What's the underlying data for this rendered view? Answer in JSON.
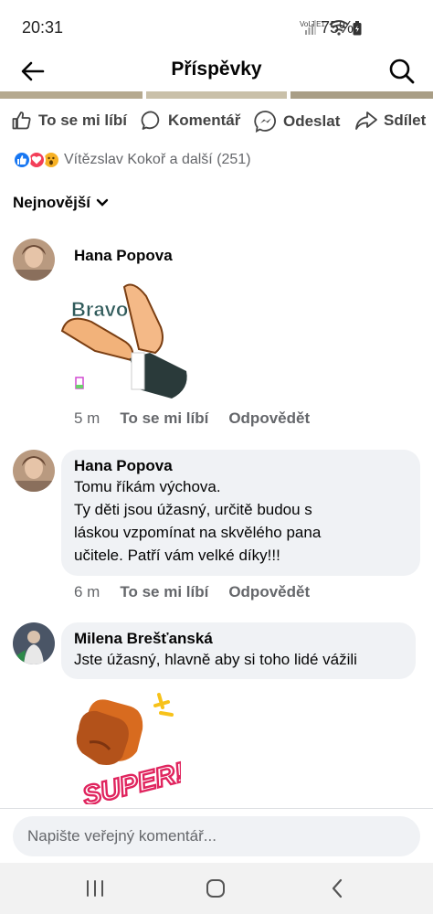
{
  "status_bar": {
    "time": "20:31",
    "battery": "75%",
    "network": "VoLTE1"
  },
  "header": {
    "title": "Příspěvky",
    "back_icon": "arrow-left-icon",
    "search_icon": "search-icon"
  },
  "actions": {
    "like": "To se mi líbí",
    "comment": "Komentář",
    "send": "Odeslat",
    "share": "Sdílet"
  },
  "reactions": {
    "summary": "Vítězslav Kokoř a další (251)",
    "icons": [
      "like-reaction-icon",
      "love-reaction-icon",
      "wow-reaction-icon"
    ]
  },
  "sort": {
    "label": "Nejnovější"
  },
  "comments": [
    {
      "author": "Hana Popova",
      "sticker_text": "Bravo",
      "time": "5 m",
      "like": "To se mi líbí",
      "reply": "Odpovědět"
    },
    {
      "author": "Hana Popova",
      "lines": [
        "Tomu říkám výchova.",
        "Ty děti jsou úžasný, určitě budou s",
        "láskou vzpomínat na skvělého pana",
        "učitele. Patří vám velké díky!!!"
      ],
      "time": "6 m",
      "like": "To se mi líbí",
      "reply": "Odpovědět"
    },
    {
      "author": "Milena Brešťanská",
      "text": "Jste úžasný, hlavně aby si toho lidé vážili",
      "sticker_text": "SUPER!"
    }
  ],
  "composer": {
    "placeholder": "Napište veřejný komentář..."
  },
  "colors": {
    "accent": "#1877f2",
    "love": "#f33e58",
    "wow": "#f7b125",
    "bubble": "#f0f2f5",
    "meta": "#65676b"
  }
}
